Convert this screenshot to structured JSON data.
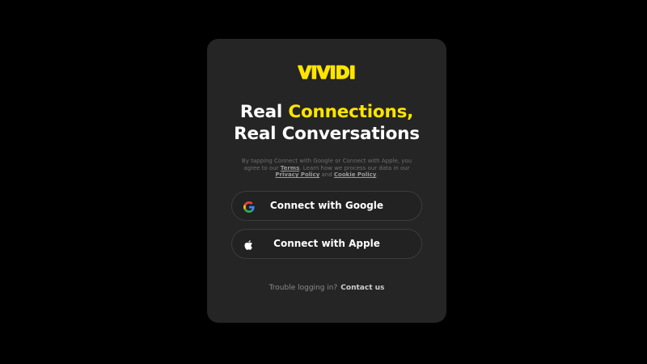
{
  "brand": {
    "logo_text": "VIVIDI",
    "accent_color": "#ffe500"
  },
  "headline": {
    "line1_prefix": "Real ",
    "line1_accent": "Connections,",
    "line2": "Real Conversations"
  },
  "legal": {
    "text_before_terms": "By tapping Connect with Google or Connect with Apple, you agree to our ",
    "terms_link": "Terms",
    "text_between": ". Learn how we process our data in our ",
    "privacy_link": "Privacy Policy",
    "text_and": " and ",
    "cookie_link": "Cookie Policy",
    "text_end": "."
  },
  "buttons": {
    "google": {
      "label": "Connect with Google",
      "icon": "google-icon"
    },
    "apple": {
      "label": "Connect with Apple",
      "icon": "apple-icon"
    }
  },
  "footer": {
    "trouble_text": "Trouble logging in?",
    "contact_link": "Contact us"
  }
}
